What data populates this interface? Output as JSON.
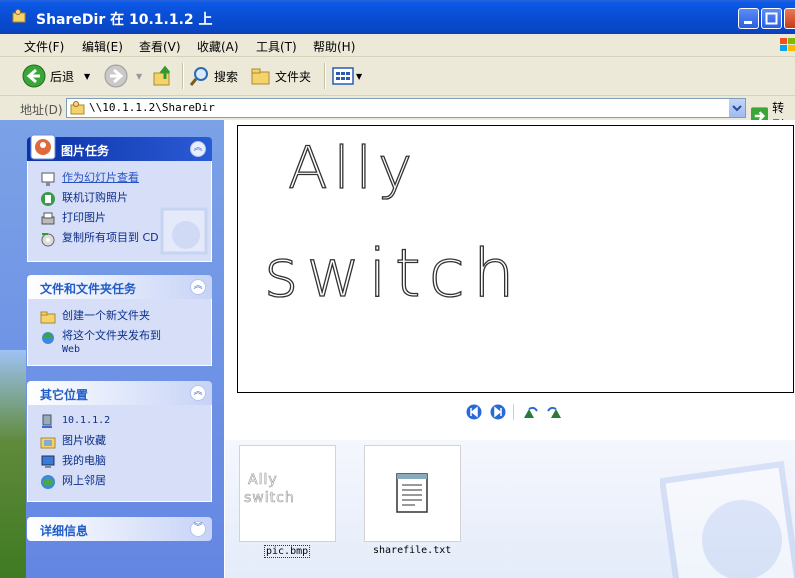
{
  "window": {
    "title": "ShareDir 在 10.1.1.2 上"
  },
  "menu": [
    "文件(F)",
    "编辑(E)",
    "查看(V)",
    "收藏(A)",
    "工具(T)",
    "帮助(H)"
  ],
  "toolbar": {
    "back": "后退",
    "search": "搜索",
    "folders": "文件夹"
  },
  "address": {
    "label": "地址(D)",
    "value": "\\\\10.1.1.2\\ShareDir",
    "go": "转到"
  },
  "panels": {
    "picture_tasks": {
      "title": "图片任务",
      "items": [
        "作为幻灯片查看",
        "联机订购照片",
        "打印图片",
        "复制所有项目到 CD"
      ]
    },
    "file_tasks": {
      "title": "文件和文件夹任务",
      "items": [
        "创建一个新文件夹",
        "将这个文件夹发布到",
        "Web"
      ]
    },
    "other_places": {
      "title": "其它位置",
      "items": [
        "10.1.1.2",
        "图片收藏",
        "我的电脑",
        "网上邻居"
      ]
    },
    "details": {
      "title": "详细信息"
    }
  },
  "files": [
    {
      "name": "pic.bmp",
      "selected": true
    },
    {
      "name": "sharefile.txt",
      "selected": false
    }
  ],
  "preview": {
    "handwriting": [
      "Ally",
      "switch"
    ]
  },
  "thumb_handwriting": [
    "Ally",
    "switch"
  ]
}
